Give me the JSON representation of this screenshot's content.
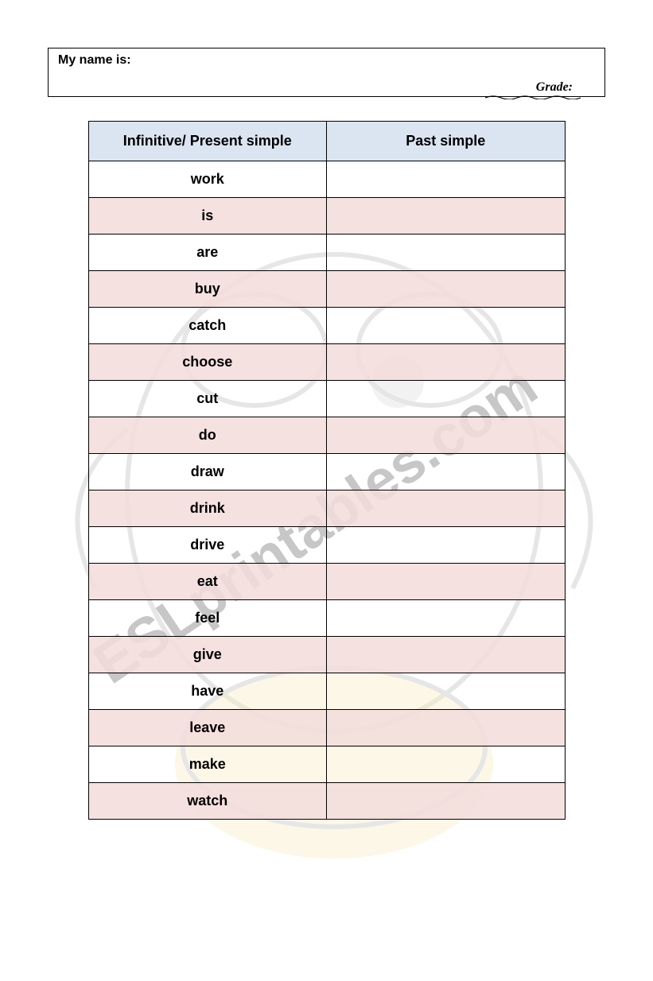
{
  "header": {
    "name_label": "My name is:",
    "grade_label": "Grade:"
  },
  "table": {
    "headers": {
      "left": "Infinitive/ Present simple",
      "right": "Past simple"
    },
    "rows": [
      {
        "infinitive": "work",
        "past": "",
        "shade": "white"
      },
      {
        "infinitive": "is",
        "past": "",
        "shade": "pink"
      },
      {
        "infinitive": "are",
        "past": "",
        "shade": "white"
      },
      {
        "infinitive": "buy",
        "past": "",
        "shade": "pink"
      },
      {
        "infinitive": "catch",
        "past": "",
        "shade": "white"
      },
      {
        "infinitive": "choose",
        "past": "",
        "shade": "pink"
      },
      {
        "infinitive": "cut",
        "past": "",
        "shade": "white"
      },
      {
        "infinitive": "do",
        "past": "",
        "shade": "pink"
      },
      {
        "infinitive": "draw",
        "past": "",
        "shade": "white"
      },
      {
        "infinitive": "drink",
        "past": "",
        "shade": "pink"
      },
      {
        "infinitive": "drive",
        "past": "",
        "shade": "white"
      },
      {
        "infinitive": "eat",
        "past": "",
        "shade": "pink"
      },
      {
        "infinitive": "feel",
        "past": "",
        "shade": "white"
      },
      {
        "infinitive": "give",
        "past": "",
        "shade": "pink"
      },
      {
        "infinitive": "have",
        "past": "",
        "shade": "white"
      },
      {
        "infinitive": "leave",
        "past": "",
        "shade": "pink"
      },
      {
        "infinitive": "make",
        "past": "",
        "shade": "white"
      },
      {
        "infinitive": "watch",
        "past": "",
        "shade": "pink"
      }
    ]
  },
  "watermark_text": "ESLprintables.com"
}
